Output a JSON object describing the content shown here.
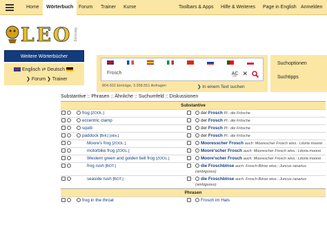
{
  "nav": {
    "home": "Home",
    "dict": "Wörterbuch",
    "forum": "Forum",
    "trainer": "Trainer",
    "courses": "Kurse",
    "toolbars": "Toolbars & Apps",
    "help": "Hilfe & Weiteres",
    "page_en": "Page in English",
    "login": "Anmelden"
  },
  "logo": {
    "text": "LEO",
    "ad": "Werbung"
  },
  "side": {
    "more_dicts": "Weitere Wörterbücher",
    "lang_from": "Englisch",
    "lang_swap": "⇄",
    "lang_to": "Deutsch",
    "forum": "Forum",
    "trainer": "Trainer"
  },
  "search": {
    "value": "Frosch",
    "ac": "A͟C",
    "entries": "804.602 Einträge, 3.358.551 Anfragen",
    "in_text": "In einem Text suchen"
  },
  "right": {
    "options": "Suchoptionen",
    "tips": "Suchtipps"
  },
  "filters": "Substantive :: Phrasen :: Ähnliche :: Suchumfeld :: Diskussionen",
  "sections": {
    "nouns": "Substantive",
    "phrases": "Phrasen"
  },
  "rows": [
    {
      "en": "frog",
      "en_tag": "[ZOOL.]",
      "de_art": "der",
      "de": "Frosch",
      "de_note": "Pl.: die Frösche"
    },
    {
      "en": "eccentric clamp",
      "en_tag": "",
      "de_art": "der",
      "de": "Frosch",
      "de_note": "Pl.: die Frösche"
    },
    {
      "en": "squib",
      "en_tag": "",
      "de_art": "der",
      "de": "Frosch",
      "de_note": "Pl.: die Frösche"
    },
    {
      "en": "paddock",
      "en_tag": "[Brit.] [obs.]",
      "de_art": "der",
      "de": "Frosch",
      "de_note": "Pl.: die Frösche"
    },
    {
      "en": "Moore's frog",
      "en_tag": "[ZOOL.]",
      "de_art": "",
      "de": "Mooresscher Frosch",
      "de_note": "auch: Moorescher Frosch  wiss.: Litoria moorei"
    },
    {
      "en": "motorbike frog",
      "en_tag": "[ZOOL.]",
      "de_art": "",
      "de": "Moore'scher Frosch",
      "de_note": "auch: Moorescher Frosch  wiss.: Litoria moorei"
    },
    {
      "en": "Western green and golden bell frog",
      "en_tag": "[ZOOL.]",
      "de_art": "",
      "de": "Moore'scher Frosch",
      "de_note": "auch: Moorescher Frosch  wiss.: Litoria moorei"
    },
    {
      "en": "frog rush",
      "en_tag": "[BOT.]",
      "de_art": "",
      "de": "die Froschbinse",
      "de_note": "auch: Frosch-Binse  wiss.: Juncus ranarius (ambiguous)"
    },
    {
      "en": "seaside rush",
      "en_tag": "[BOT.]",
      "de_art": "",
      "de": "die Froschbinse",
      "de_note": "auch: Frosch-Binse  wiss.: Juncus ranarius (ambiguous)"
    }
  ],
  "phrase_rows": [
    {
      "en": "frog in the throat",
      "de": "Frosch im Hals"
    }
  ]
}
